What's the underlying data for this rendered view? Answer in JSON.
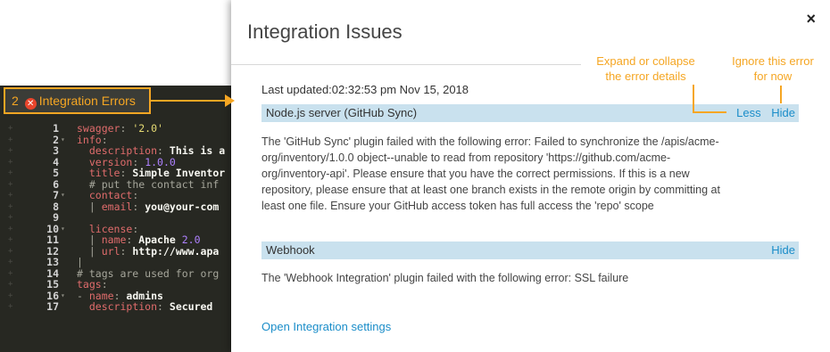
{
  "editor": {
    "error_tab": {
      "count": "2",
      "label": "Integration Errors"
    },
    "lines": [
      {
        "num": "1",
        "fold": "",
        "html": "<span class='k'>swagger</span><span class='c'>: </span><span class='s'>'2.0'</span>"
      },
      {
        "num": "2",
        "fold": "▾",
        "html": "<span class='k'>info</span><span class='c'>:</span>"
      },
      {
        "num": "3",
        "fold": "",
        "html": "  <span class='k'>description</span><span class='c'>: </span><span class='w'>This is a</span>"
      },
      {
        "num": "4",
        "fold": "",
        "html": "  <span class='k'>version</span><span class='c'>: </span><span class='n'>1.0.0</span>"
      },
      {
        "num": "5",
        "fold": "",
        "html": "  <span class='k'>title</span><span class='c'>: </span><span class='w'>Simple Inventor</span>"
      },
      {
        "num": "6",
        "fold": "",
        "html": "  <span class='c'># put the contact inf</span>"
      },
      {
        "num": "7",
        "fold": "▾",
        "html": "  <span class='k'>contact</span><span class='c'>:</span>"
      },
      {
        "num": "8",
        "fold": "",
        "html": "  <span class='c'>| </span><span class='k'>email</span><span class='c'>: </span><span class='w'>you@your-com</span>"
      },
      {
        "num": "9",
        "fold": "",
        "html": ""
      },
      {
        "num": "10",
        "fold": "▾",
        "html": "  <span class='k'>license</span><span class='c'>:</span>"
      },
      {
        "num": "11",
        "fold": "",
        "html": "  <span class='c'>| </span><span class='k'>name</span><span class='c'>: </span><span class='w'>Apache </span><span class='n'>2.0</span>"
      },
      {
        "num": "12",
        "fold": "",
        "html": "  <span class='c'>| </span><span class='k'>url</span><span class='c'>: </span><span class='w'>http://www.apa</span>"
      },
      {
        "num": "13",
        "fold": "",
        "html": "<span class='c'>|</span>"
      },
      {
        "num": "14",
        "fold": "",
        "html": "<span class='c'># tags are used for org</span>"
      },
      {
        "num": "15",
        "fold": "",
        "html": "<span class='k'>tags</span><span class='c'>:</span>"
      },
      {
        "num": "16",
        "fold": "▾",
        "html": "<span class='c'>- </span><span class='k'>name</span><span class='c'>: </span><span class='w'>admins</span>"
      },
      {
        "num": "17",
        "fold": "",
        "html": "  <span class='k'>description</span><span class='c'>: </span><span class='w'>Secured</span>"
      }
    ]
  },
  "modal": {
    "title": "Integration Issues",
    "close_icon": "×",
    "last_updated": "Last updated:02:32:53 pm Nov 15, 2018",
    "issues": [
      {
        "name": "Node.js server (GitHub Sync)",
        "less_label": "Less",
        "hide_label": "Hide",
        "lines": [
          "The 'GitHub Sync' plugin failed with the following error: Failed to synchronize the /apis/acme-",
          "org/inventory/1.0.0 object--unable to read from repository 'https://github.com/acme-",
          "org/inventory-api'. Please ensure that you have the correct permissions. If this is a new",
          "repository, please ensure that at least one branch exists in the remote origin by committing at",
          "least one file. Ensure your GitHub access token has full access the 'repo' scope"
        ]
      },
      {
        "name": "Webhook",
        "hide_label": "Hide",
        "lines": [
          "The 'Webhook Integration' plugin failed with the following error: SSL failure"
        ]
      }
    ],
    "settings_link": "Open Integration settings"
  },
  "annotations": {
    "expand_collapse": [
      "Expand or collapse",
      "the error details"
    ],
    "ignore": [
      "Ignore this error",
      "for now"
    ]
  },
  "colors": {
    "accent": "#f5a623",
    "link": "#1a8dc9",
    "header_bg": "#c9e1ee",
    "editor_bg": "#272822"
  }
}
